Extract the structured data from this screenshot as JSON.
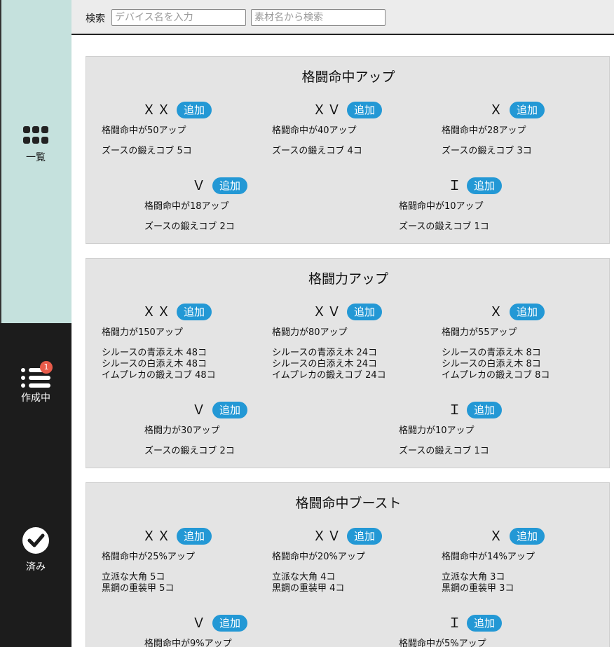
{
  "sidebar": {
    "items": [
      {
        "label": "一覧",
        "icon": "grid-icon"
      },
      {
        "label": "作成中",
        "icon": "list-icon",
        "badge": "1"
      },
      {
        "label": "済み",
        "icon": "check-icon"
      }
    ],
    "colors": {
      "top": "#c5e1dd",
      "bottom": "#1c1c1c",
      "badge": "#e85b4a"
    }
  },
  "search": {
    "label": "検索",
    "device_placeholder": "デバイス名を入力",
    "material_placeholder": "素材名から検索"
  },
  "add_label": "追加",
  "accent": "#2398d5",
  "cards": [
    {
      "title": "格闘命中アップ",
      "items": [
        {
          "grade": "ＸＸ",
          "effect": "格闘命中が50アップ",
          "materials": [
            "ズースの鍛えコブ 5コ"
          ]
        },
        {
          "grade": "ＸＶ",
          "effect": "格闘命中が40アップ",
          "materials": [
            "ズースの鍛えコブ 4コ"
          ]
        },
        {
          "grade": "Ｘ",
          "effect": "格闘命中が28アップ",
          "materials": [
            "ズースの鍛えコブ 3コ"
          ]
        },
        {
          "grade": "Ｖ",
          "effect": "格闘命中が18アップ",
          "materials": [
            "ズースの鍛えコブ 2コ"
          ]
        },
        {
          "grade": "Ｉ",
          "effect": "格闘命中が10アップ",
          "materials": [
            "ズースの鍛えコブ 1コ"
          ]
        }
      ]
    },
    {
      "title": "格闘力アップ",
      "items": [
        {
          "grade": "ＸＸ",
          "effect": "格闘力が150アップ",
          "materials": [
            "シルースの青添え木 48コ",
            "シルースの白添え木 48コ",
            "イムプレカの鍛えコブ 48コ"
          ]
        },
        {
          "grade": "ＸＶ",
          "effect": "格闘力が80アップ",
          "materials": [
            "シルースの青添え木 24コ",
            "シルースの白添え木 24コ",
            "イムプレカの鍛えコブ 24コ"
          ]
        },
        {
          "grade": "Ｘ",
          "effect": "格闘力が55アップ",
          "materials": [
            "シルースの青添え木 8コ",
            "シルースの白添え木 8コ",
            "イムプレカの鍛えコブ 8コ"
          ]
        },
        {
          "grade": "Ｖ",
          "effect": "格闘力が30アップ",
          "materials": [
            "ズースの鍛えコブ 2コ"
          ]
        },
        {
          "grade": "Ｉ",
          "effect": "格闘力が10アップ",
          "materials": [
            "ズースの鍛えコブ 1コ"
          ]
        }
      ]
    },
    {
      "title": "格闘命中ブースト",
      "items": [
        {
          "grade": "ＸＸ",
          "effect": "格闘命中が25%アップ",
          "materials": [
            "立派な大角 5コ",
            "黒鋼の重装甲 5コ"
          ]
        },
        {
          "grade": "ＸＶ",
          "effect": "格闘命中が20%アップ",
          "materials": [
            "立派な大角 4コ",
            "黒鋼の重装甲 4コ"
          ]
        },
        {
          "grade": "Ｘ",
          "effect": "格闘命中が14%アップ",
          "materials": [
            "立派な大角 3コ",
            "黒鋼の重装甲 3コ"
          ]
        },
        {
          "grade": "Ｖ",
          "effect": "格闘命中が9%アップ",
          "materials": []
        },
        {
          "grade": "Ｉ",
          "effect": "格闘命中が5%アップ",
          "materials": []
        }
      ]
    }
  ]
}
